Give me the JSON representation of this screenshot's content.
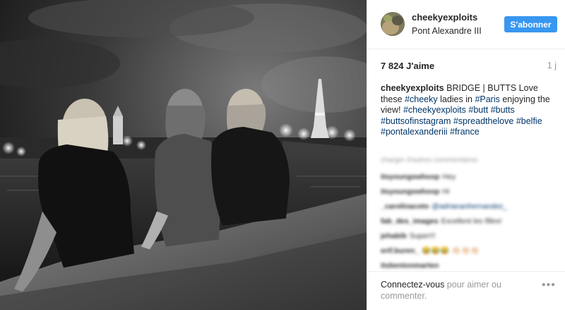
{
  "post": {
    "photo_icon": "photo-image"
  },
  "header": {
    "username": "cheekyexploits",
    "location": "Pont Alexandre III",
    "follow_label": "S'abonner"
  },
  "stats": {
    "likes": "7 824 J'aime",
    "time": "1 j"
  },
  "caption": {
    "username": "cheekyexploits",
    "segments": [
      {
        "text": " BRIDGE | BUTTS Love these ",
        "tag": false
      },
      {
        "text": "#cheeky",
        "tag": true
      },
      {
        "text": " ladies in ",
        "tag": false
      },
      {
        "text": "#Paris",
        "tag": true
      },
      {
        "text": " enjoying the view! ",
        "tag": false
      },
      {
        "text": "#cheekyexploits",
        "tag": true
      },
      {
        "text": " ",
        "tag": false
      },
      {
        "text": "#butt",
        "tag": true
      },
      {
        "text": " ",
        "tag": false
      },
      {
        "text": "#butts",
        "tag": true
      },
      {
        "text": " ",
        "tag": false
      },
      {
        "text": "#buttsofinstagram",
        "tag": true
      },
      {
        "text": " ",
        "tag": false
      },
      {
        "text": "#spreadthelove",
        "tag": true
      },
      {
        "text": " ",
        "tag": false
      },
      {
        "text": "#belfie",
        "tag": true
      },
      {
        "text": " ",
        "tag": false
      },
      {
        "text": "#pontalexanderiii",
        "tag": true
      },
      {
        "text": " ",
        "tag": false
      },
      {
        "text": "#france",
        "tag": true
      }
    ]
  },
  "comments": {
    "load_more": "charger d'autres commentaires",
    "items": [
      {
        "user": "itsyoungswhoop",
        "text": "Hey",
        "mention": ""
      },
      {
        "user": "itsyoungswhoop",
        "text": "Hi",
        "mention": ""
      },
      {
        "user": "_carolinacoto",
        "text": "",
        "mention": "@adriananhernandez_"
      },
      {
        "user": "fab_des_images",
        "text": "Excellent les filles!",
        "mention": ""
      },
      {
        "user": "jehabib",
        "text": "Super!!!",
        "mention": ""
      },
      {
        "user": "erif.buren_",
        "text": "😂😂😂 👏🏻👏🏻👏🏻",
        "mention": ""
      },
      {
        "user": "itsbentonmarten",
        "text": "",
        "mention": ""
      }
    ]
  },
  "footer": {
    "login_link": "Connectez-vous",
    "login_rest": " pour aimer ou commenter.",
    "more_label": "•••"
  },
  "colors": {
    "accent": "#3897f0",
    "hashtag": "#003569",
    "muted": "#999999",
    "text": "#262626"
  }
}
